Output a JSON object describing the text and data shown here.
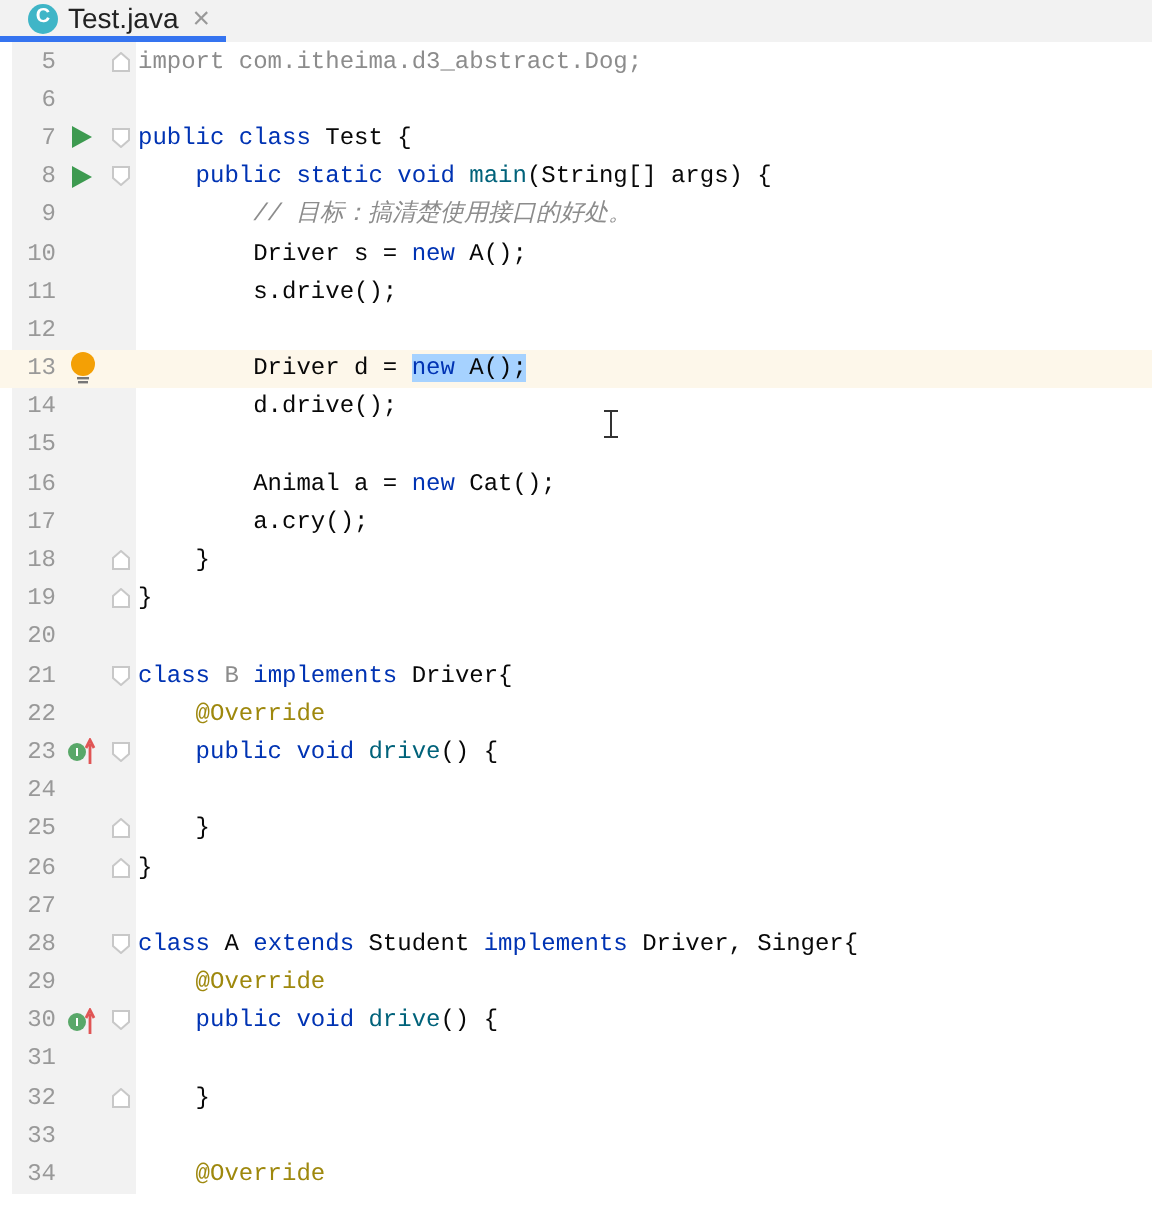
{
  "tab": {
    "title": "Test.java",
    "icon_letter": "C",
    "selected": true,
    "close": "×"
  },
  "lines": [
    {
      "number": "5",
      "fold_marker": {
        "kind": "end"
      },
      "current": false,
      "tokens": [
        {
          "text": "import com.itheima.d3_abstract.Dog;",
          "kind": "unused"
        }
      ]
    },
    {
      "number": "6",
      "current": false
    },
    {
      "number": "7",
      "gutter_marker": {
        "kind": "run"
      },
      "fold_marker": {
        "kind": "start"
      },
      "current": false,
      "tokens": [
        {
          "text": "public class ",
          "kind": "keyword"
        },
        {
          "text": "Test {",
          "kind": "plain"
        }
      ]
    },
    {
      "number": "8",
      "gutter_marker": {
        "kind": "run"
      },
      "fold_marker": {
        "kind": "start"
      },
      "current": false,
      "tokens": [
        {
          "text": "    public static void ",
          "kind": "keyword"
        },
        {
          "text": "main",
          "kind": "method"
        },
        {
          "text": "(String[] args) {",
          "kind": "plain"
        }
      ]
    },
    {
      "number": "9",
      "current": false,
      "tokens": [
        {
          "text": "        // 目标：搞清楚使用接口的好处。",
          "kind": "comment"
        }
      ]
    },
    {
      "number": "10",
      "current": false,
      "tokens": [
        {
          "text": "        Driver s = ",
          "kind": "plain"
        },
        {
          "text": "new ",
          "kind": "keyword"
        },
        {
          "text": "A();",
          "kind": "plain"
        }
      ]
    },
    {
      "number": "11",
      "current": false,
      "tokens": [
        {
          "text": "        s.drive();",
          "kind": "plain"
        }
      ]
    },
    {
      "number": "12",
      "current": false
    },
    {
      "number": "13",
      "gutter_marker": {
        "kind": "bulb"
      },
      "current": true,
      "tokens": [
        {
          "text": "        Driver d = ",
          "kind": "plain"
        },
        {
          "text": "new ",
          "kind": "keyword",
          "selected": true
        },
        {
          "text": "A();",
          "kind": "plain",
          "selected": true
        }
      ]
    },
    {
      "number": "14",
      "current": false,
      "tokens": [
        {
          "text": "        d.drive();",
          "kind": "plain"
        }
      ]
    },
    {
      "number": "15",
      "current": false
    },
    {
      "number": "16",
      "current": false,
      "tokens": [
        {
          "text": "        Animal a = ",
          "kind": "plain"
        },
        {
          "text": "new ",
          "kind": "keyword"
        },
        {
          "text": "Cat();",
          "kind": "plain"
        }
      ]
    },
    {
      "number": "17",
      "current": false,
      "tokens": [
        {
          "text": "        a.cry();",
          "kind": "plain"
        }
      ]
    },
    {
      "number": "18",
      "fold_marker": {
        "kind": "end"
      },
      "current": false,
      "tokens": [
        {
          "text": "    }",
          "kind": "plain"
        }
      ]
    },
    {
      "number": "19",
      "fold_marker": {
        "kind": "end"
      },
      "current": false,
      "tokens": [
        {
          "text": "}",
          "kind": "plain"
        }
      ]
    },
    {
      "number": "20",
      "current": false
    },
    {
      "number": "21",
      "fold_marker": {
        "kind": "start"
      },
      "current": false,
      "tokens": [
        {
          "text": "class ",
          "kind": "keyword"
        },
        {
          "text": "B ",
          "kind": "unused"
        },
        {
          "text": "implements ",
          "kind": "keyword"
        },
        {
          "text": "Driver{",
          "kind": "plain"
        }
      ]
    },
    {
      "number": "22",
      "current": false,
      "tokens": [
        {
          "text": "    @Override",
          "kind": "annotation"
        }
      ]
    },
    {
      "number": "23",
      "gutter_marker": {
        "kind": "implements"
      },
      "fold_marker": {
        "kind": "start"
      },
      "current": false,
      "tokens": [
        {
          "text": "    public void ",
          "kind": "keyword"
        },
        {
          "text": "drive",
          "kind": "method"
        },
        {
          "text": "() {",
          "kind": "plain"
        }
      ]
    },
    {
      "number": "24",
      "current": false
    },
    {
      "number": "25",
      "fold_marker": {
        "kind": "end"
      },
      "current": false,
      "tokens": [
        {
          "text": "    }",
          "kind": "plain"
        }
      ]
    },
    {
      "number": "26",
      "fold_marker": {
        "kind": "end"
      },
      "current": false,
      "tokens": [
        {
          "text": "}",
          "kind": "plain"
        }
      ]
    },
    {
      "number": "27",
      "current": false
    },
    {
      "number": "28",
      "fold_marker": {
        "kind": "start"
      },
      "current": false,
      "tokens": [
        {
          "text": "class ",
          "kind": "keyword"
        },
        {
          "text": "A ",
          "kind": "plain"
        },
        {
          "text": "extends ",
          "kind": "keyword"
        },
        {
          "text": "Student ",
          "kind": "plain"
        },
        {
          "text": "implements ",
          "kind": "keyword"
        },
        {
          "text": "Driver, Singer{",
          "kind": "plain"
        }
      ]
    },
    {
      "number": "29",
      "current": false,
      "tokens": [
        {
          "text": "    @Override",
          "kind": "annotation"
        }
      ]
    },
    {
      "number": "30",
      "gutter_marker": {
        "kind": "implements"
      },
      "fold_marker": {
        "kind": "start"
      },
      "current": false,
      "tokens": [
        {
          "text": "    public void ",
          "kind": "keyword"
        },
        {
          "text": "drive",
          "kind": "method"
        },
        {
          "text": "() {",
          "kind": "plain"
        }
      ]
    },
    {
      "number": "31",
      "current": false
    },
    {
      "number": "32",
      "fold_marker": {
        "kind": "end"
      },
      "current": false,
      "tokens": [
        {
          "text": "    }",
          "kind": "plain"
        }
      ]
    },
    {
      "number": "33",
      "current": false
    },
    {
      "number": "34",
      "current": false,
      "tokens": [
        {
          "text": "    @Override",
          "kind": "annotation"
        }
      ]
    }
  ]
}
